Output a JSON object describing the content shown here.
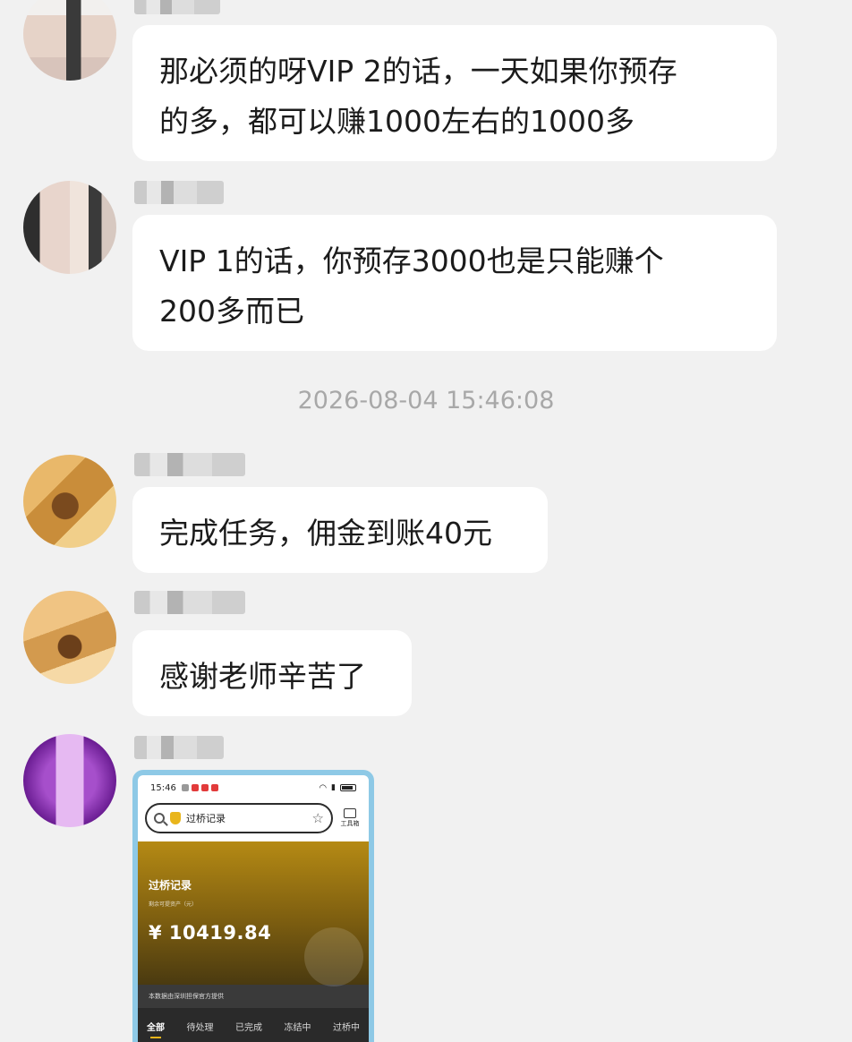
{
  "timestamp": "2026-08-04 15:46:08",
  "messages": [
    {
      "lines": [
        "那必须的呀VIP 2的话，一天如果你预存",
        "的多，都可以赚1000左右的1000多"
      ]
    },
    {
      "lines": [
        "VIP 1的话，你预存3000也是只能赚个",
        "200多而已"
      ]
    },
    {
      "lines": [
        "完成任务，佣金到账40元"
      ]
    },
    {
      "lines": [
        "感谢老师辛苦了"
      ]
    }
  ],
  "screenshot": {
    "status_time": "15:46",
    "search_text": "过桥记录",
    "tool_label": "工具箱",
    "panel_title": "过桥记录",
    "panel_subtitle": "剩余可提资产（元）",
    "amount": "¥  10419.84",
    "notice": "本数据由深圳担保官方提供",
    "tabs": [
      "全部",
      "待处理",
      "已完成",
      "冻结中",
      "过桥中"
    ]
  },
  "colors": {
    "background": "#f1f1f1",
    "bubble": "#ffffff",
    "timestamp": "#a8a8a8",
    "panel_gold": "#b58a14",
    "frame": "#8ec9e6"
  }
}
